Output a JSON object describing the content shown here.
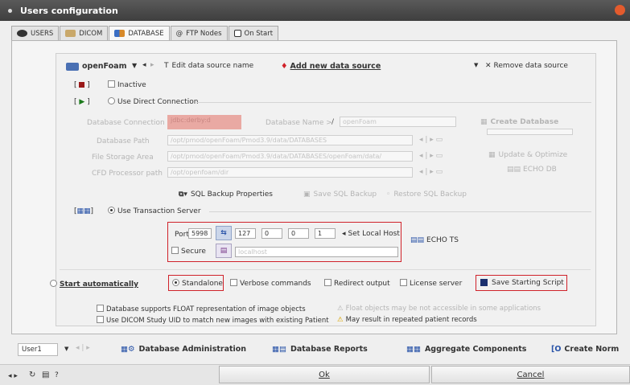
{
  "window": {
    "title": "Users configuration"
  },
  "tabs": [
    {
      "label": "USERS"
    },
    {
      "label": "DICOM"
    },
    {
      "label": "DATABASE"
    },
    {
      "label": "FTP Nodes"
    },
    {
      "label": "On Start"
    }
  ],
  "source_bar": {
    "selected_source": "openFoam",
    "edit_label": "Edit data source name",
    "add_label": "Add new data source",
    "remove_label": "Remove data source"
  },
  "inactive_label": "Inactive",
  "direct": {
    "use_label": "Use Direct Connection",
    "db_connection_label": "Database Connection",
    "db_connection_value": "jdbc:derby:d",
    "db_name_label": "Database Name >",
    "db_name_value": "openFoam",
    "create_db_label": "Create Database",
    "db_path_label": "Database Path",
    "db_path_value": "/opt/pmod/openFoam/Pmod3.9/data/DATABASES",
    "file_storage_label": "File Storage Area",
    "file_storage_value": "/opt/pmod/openFoam/Pmod3.9/data/DATABASES/openFoam/data/",
    "cfd_path_label": "CFD Processor path",
    "cfd_path_value": "/opt/openfoam/dir",
    "update_optimize_label": "Update & Optimize",
    "echo_db_label": "ECHO DB",
    "sql_backup_props_label": "SQL Backup Properties",
    "save_sql_label": "Save SQL Backup",
    "restore_sql_label": "Restore SQL Backup"
  },
  "server": {
    "use_label": "Use Transaction Server",
    "port_label": "Port",
    "port_value": "5998",
    "ip": [
      "127",
      "0",
      "0",
      "1"
    ],
    "set_local_host_label": "Set Local Host",
    "echo_ts_label": "ECHO TS",
    "secure_label": "Secure",
    "host_value": "localhost"
  },
  "startup": {
    "start_auto_label": "Start automatically",
    "standalone_label": "Standalone",
    "verbose_label": "Verbose commands",
    "redirect_label": "Redirect output",
    "license_label": "License server",
    "save_script_label": "Save Starting Script"
  },
  "options": {
    "float_label": "Database supports FLOAT representation of image objects",
    "float_warning": "Float objects may be not accessible in some applications",
    "dicom_uid_label": "Use DICOM Study UID to match new images with existing Patient",
    "dicom_uid_warning": "May result in repeated patient records"
  },
  "bottom": {
    "user_value": "User1",
    "db_admin_label": "Database Administration",
    "db_reports_label": "Database Reports",
    "aggregate_label": "Aggregate Components",
    "create_norm_label": "Create Norm"
  },
  "footer": {
    "help_label": "?",
    "ok_label": "Ok",
    "cancel_label": "Cancel"
  },
  "colors": {
    "highlight": "#d0222a",
    "title_bg": "#4a4a4a",
    "accent_blue": "#2a54a8"
  }
}
